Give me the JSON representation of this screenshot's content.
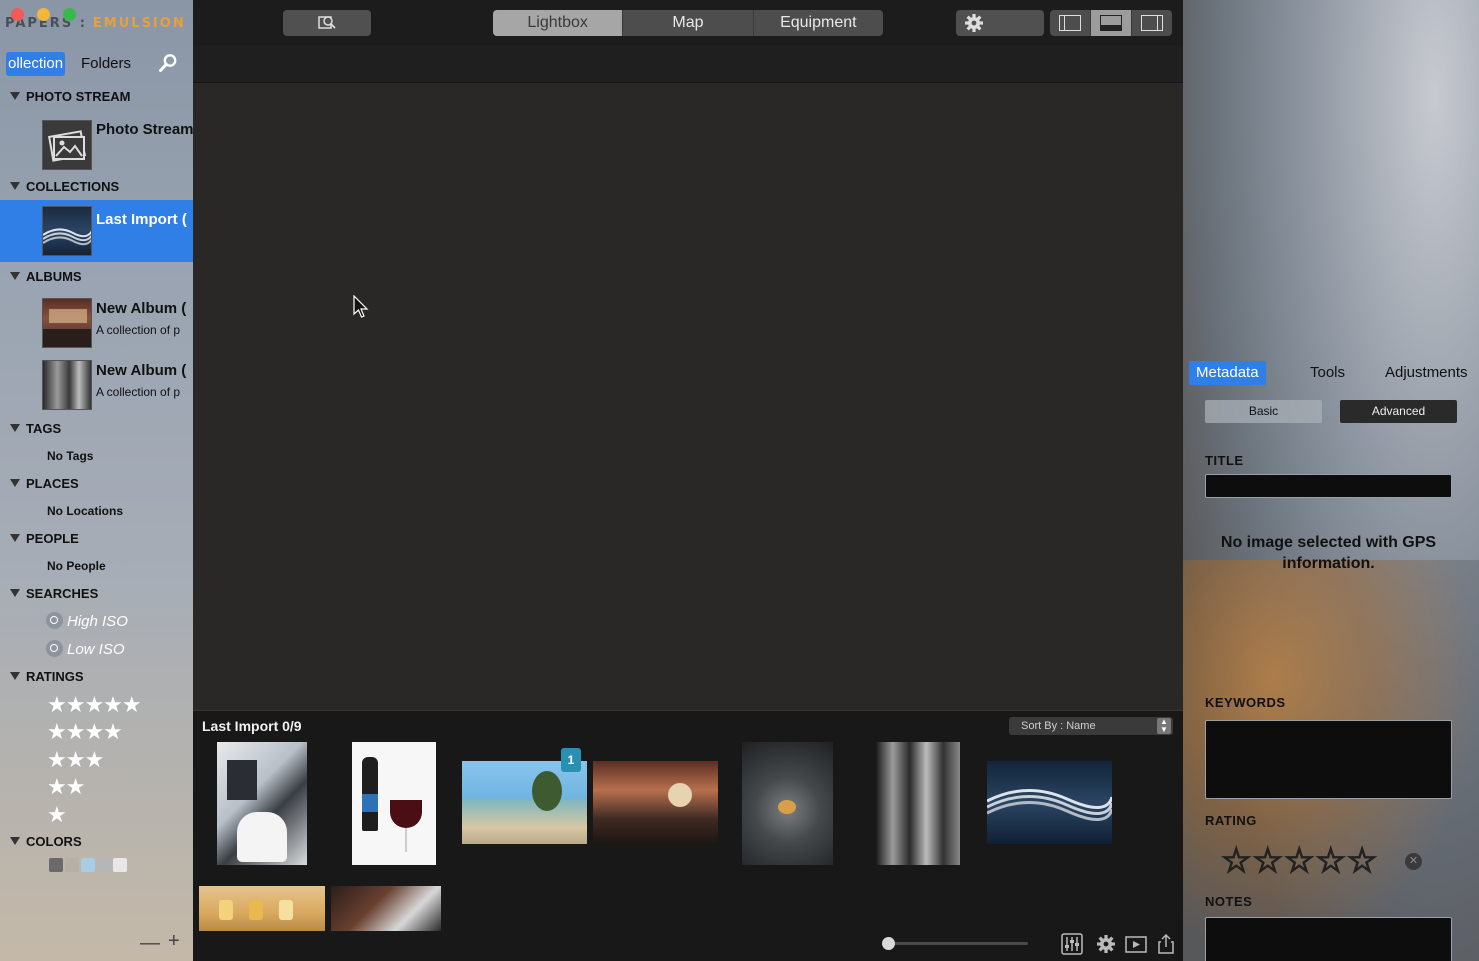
{
  "window": {
    "app_title_prefix": "PAPERS :",
    "app_title_brand": "EMULSION"
  },
  "sidebar": {
    "tab_collection": "ollection",
    "tab_folders": "Folders",
    "sections": {
      "photo_stream": "PHOTO STREAM",
      "collections": "COLLECTIONS",
      "albums": "ALBUMS",
      "tags": "TAGS",
      "places": "PLACES",
      "people": "PEOPLE",
      "searches": "SEARCHES",
      "ratings": "RATINGS",
      "colors": "COLORS"
    },
    "photo_stream_item": {
      "title": "Photo Stream"
    },
    "collection_item": {
      "title": "Last Import ("
    },
    "albums": [
      {
        "title": "New Album (",
        "subtitle": "A collection of p"
      },
      {
        "title": "New Album (",
        "subtitle": "A collection of p"
      }
    ],
    "tags_empty": "No Tags",
    "places_empty": "No Locations",
    "people_empty": "No People",
    "searches": [
      "High ISO",
      "Low ISO"
    ],
    "ratings": [
      "★★★★★",
      "★★★★",
      "★★★",
      "★★",
      "★"
    ],
    "colors": [
      "#6a6a6a",
      "#b8b0a6",
      "#a8cde6",
      "#b6b6b6",
      "#e8e8e8"
    ],
    "footer_minus": "—",
    "footer_plus": "+"
  },
  "toolbar": {
    "view_tabs": [
      "Lightbox",
      "Map",
      "Equipment"
    ],
    "active_view": "Lightbox",
    "layout_modes": [
      "left-panel",
      "bottom-panel",
      "right-panel"
    ],
    "active_layout": "bottom-panel"
  },
  "filmstrip": {
    "title": "Last Import 0/9",
    "sort_label": "Sort By : Name",
    "badge_count": "1"
  },
  "inspector": {
    "tabs": [
      "Metadata",
      "Tools",
      "Adjustments"
    ],
    "active_tab": "Metadata",
    "mode_basic": "Basic",
    "mode_advanced": "Advanced",
    "title_label": "TITLE",
    "gps_message": "No image selected with GPS information.",
    "keywords_label": "KEYWORDS",
    "rating_label": "RATING",
    "rating_value": 0,
    "rating_stars": "☆☆☆☆☆",
    "rating_clear": "✕",
    "notes_label": "NOTES"
  },
  "colors": {
    "accent": "#2f7fe6",
    "brand": "#e8a03a",
    "badge": "#2a8fb1"
  }
}
